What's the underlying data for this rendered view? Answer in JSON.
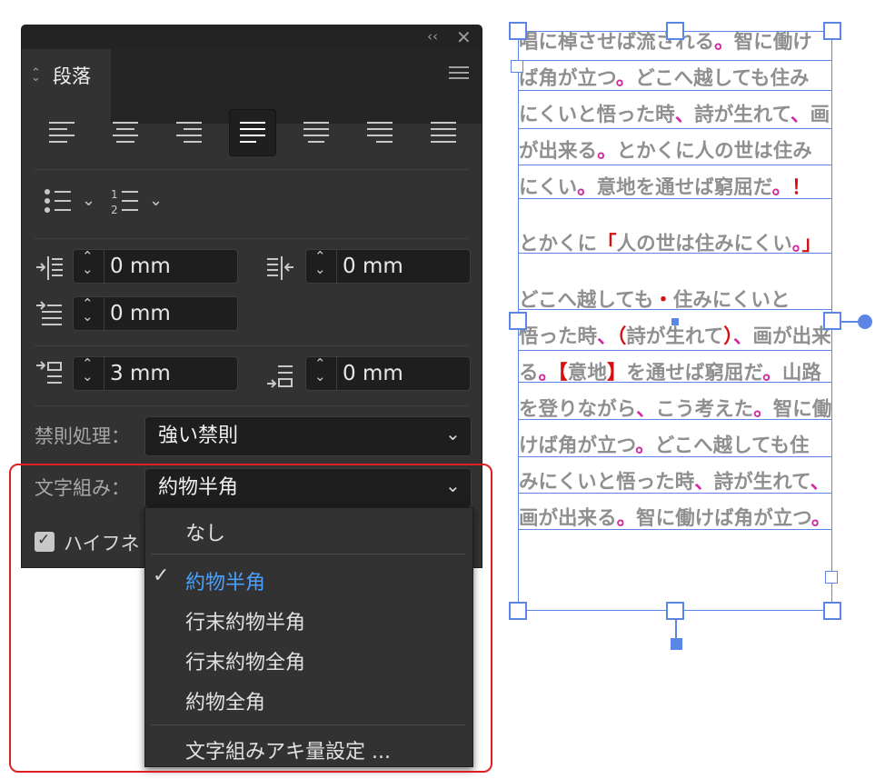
{
  "panel": {
    "tab_title": "段落",
    "alignment_buttons": [
      "align-left",
      "align-center",
      "align-right",
      "justify-last-left",
      "justify-last-center",
      "justify-last-right",
      "justify-all"
    ],
    "selected_alignment": "justify-last-left",
    "left_indent": "0 mm",
    "right_indent": "0 mm",
    "first_line_indent": "0 mm",
    "space_before": "3 mm",
    "space_after": "0 mm",
    "kinsoku_label": "禁則処理：",
    "kinsoku_value": "強い禁則",
    "mojikumi_label": "文字組み：",
    "mojikumi_value": "約物半角",
    "hyphen_label": "ハイフネ"
  },
  "menu": {
    "items": [
      "なし",
      "約物半角",
      "行末約物半角",
      "行末約物全角",
      "約物全角",
      "文字組みアキ量設定 ..."
    ],
    "selected": "約物半角"
  },
  "frame_text": {
    "lines": [
      "唱に棹させば流される。智に働け",
      "ば角が立つ。どこへ越しても住み",
      "にくいと悟った時、詩が生れて、画",
      "が出来る。とかくに人の世は住み",
      "にくい。意地を通せば窮屈だ。！",
      "とかくに「人の世は住みにくい。」",
      "どこへ越しても・住みにくいと",
      "悟った時、（詩が生れて）、画が出来",
      "る。【意地】を通せば窮屈だ。山路",
      "を登りながら、こう考えた。智に働",
      "けば角が立つ。どこへ越しても住",
      "みにくいと悟った時、詩が生れて、",
      "画が出来る。智に働けば角が立つ。"
    ]
  },
  "colors": {
    "accent": "#4aa0ff",
    "highlight_box": "#e02020",
    "frame": "#5b86e6"
  }
}
